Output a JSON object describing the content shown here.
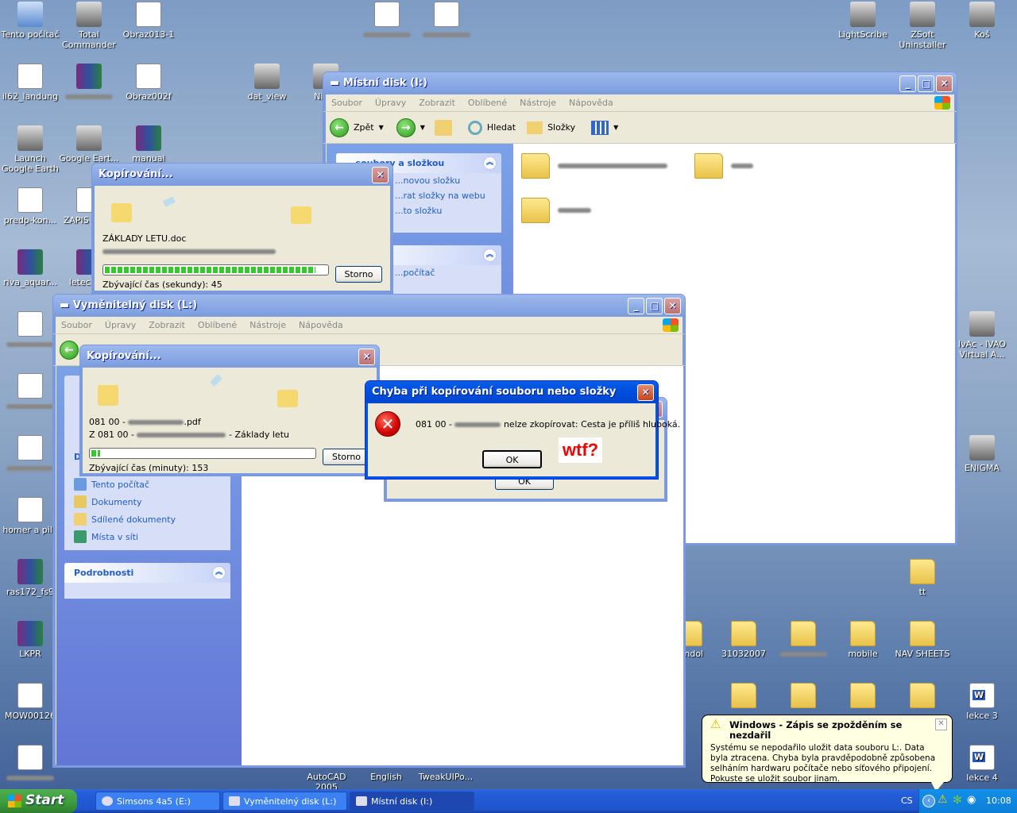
{
  "desktop": {
    "icons": [
      {
        "label": "Tento počítač",
        "type": "pc"
      },
      {
        "label": "Total Commander",
        "type": "app"
      },
      {
        "label": "Obraz013-1",
        "type": "file"
      },
      {
        "label": "",
        "type": "file",
        "blurred": true
      },
      {
        "label": "",
        "type": "file",
        "blurred": true
      },
      {
        "label": "LightScribe",
        "type": "app"
      },
      {
        "label": "ZSoft Uninstaller",
        "type": "app"
      },
      {
        "label": "Koš",
        "type": "app"
      },
      {
        "label": "il62_landung",
        "type": "file"
      },
      {
        "label": "",
        "type": "rar",
        "blurred": true
      },
      {
        "label": "Obraz002f",
        "type": "file"
      },
      {
        "label": "dat_view",
        "type": "app"
      },
      {
        "label": "Nitr...",
        "type": "app"
      },
      {
        "label": "Launch Google Earth",
        "type": "app"
      },
      {
        "label": "Google Eart...",
        "type": "app"
      },
      {
        "label": "manual",
        "type": "rar"
      },
      {
        "label": "predp-kon...",
        "type": "file"
      },
      {
        "label": "ZAPIS LET...",
        "type": "file"
      },
      {
        "label": "riva_aquar...",
        "type": "rar"
      },
      {
        "label": "letecka...",
        "type": "rar"
      },
      {
        "label": "",
        "type": "file",
        "blurred": true
      },
      {
        "label": "",
        "type": "file",
        "blurred": true
      },
      {
        "label": "",
        "type": "file",
        "blurred": true
      },
      {
        "label": "homer a pilo",
        "type": "file"
      },
      {
        "label": "ras172_fs9",
        "type": "rar"
      },
      {
        "label": "LKPR",
        "type": "rar"
      },
      {
        "label": "MOW00126",
        "type": "file"
      },
      {
        "label": "",
        "type": "file",
        "blurred": true
      },
      {
        "label": "IvAc - IVAO Virtual A...",
        "type": "app"
      },
      {
        "label": "ENIGMA",
        "type": "app"
      },
      {
        "label": "tt",
        "type": "folder"
      },
      {
        "label": "...ndol",
        "type": "folder"
      },
      {
        "label": "31032007",
        "type": "folder"
      },
      {
        "label": "",
        "type": "folder",
        "blurred": true
      },
      {
        "label": "mobile",
        "type": "folder"
      },
      {
        "label": "NAV SHEETS",
        "type": "folder"
      },
      {
        "label": "",
        "type": "folder"
      },
      {
        "label": "",
        "type": "folder"
      },
      {
        "label": "",
        "type": "folder"
      },
      {
        "label": "",
        "type": "folder"
      },
      {
        "label": "lekce 3",
        "type": "word"
      },
      {
        "label": "lekce 4",
        "type": "word"
      },
      {
        "label": "AutoCAD 2005",
        "type": "none"
      },
      {
        "label": "English",
        "type": "none"
      },
      {
        "label": "TweakUIPo...",
        "type": "none"
      }
    ]
  },
  "menu": [
    "Soubor",
    "Úpravy",
    "Zobrazit",
    "Oblíbené",
    "Nástroje",
    "Nápověda"
  ],
  "win_i": {
    "title": "Místní disk (I:)",
    "toolbar": {
      "back": "Zpět",
      "search": "Hledat",
      "folders": "Složky"
    },
    "task_panel": {
      "title": "...soubory a složkou",
      "links": [
        "...novou složku",
        "...rat složky na webu",
        "...to složku"
      ]
    },
    "other_panel": {
      "links": [
        "...počítač"
      ]
    },
    "folders": [
      "",
      "",
      ""
    ]
  },
  "win_l": {
    "title": "Vyměnitelný disk (L:)",
    "places_panel": {
      "title": "D...",
      "links": [
        "Tento počítač",
        "Dokumenty",
        "Sdílené dokumenty",
        "Místa v síti"
      ]
    },
    "details_panel": {
      "title": "Podrobnosti"
    }
  },
  "copy1": {
    "title": "Kopírování...",
    "file": "ZÁKLADY LETU.doc",
    "progress_pct": 95,
    "remaining": "Zbývající čas (sekundy): 45",
    "cancel": "Storno"
  },
  "copy2": {
    "title": "Kopírování...",
    "file_prefix": "081 00 - ",
    "file_suffix": ".pdf",
    "from_prefix": "Z 081 00 - ",
    "from_suffix": " - Základy letu",
    "progress_pct": 4,
    "remaining": "Zbývající čas (minuty): 153",
    "cancel": "Storno"
  },
  "behind_dialog": {
    "ok": "OK"
  },
  "error_dialog": {
    "title": "Chyba při kopírování souboru nebo složky",
    "msg_prefix": "081 00 - ",
    "msg_suffix": " nelze zkopírovat: Cesta je příliš hluboká.",
    "ok": "OK",
    "annotation": "wtf?"
  },
  "balloon": {
    "title": "Windows - Zápis se zpožděním se nezdařil",
    "body": "Systému se nepodařilo uložit data souboru L:. Data byla ztracena. Chyba byla pravděpodobně způsobena selháním hardwaru počítače nebo síťového připojení. Pokuste se uložit soubor jinam."
  },
  "taskbar": {
    "start": "Start",
    "tasks": [
      {
        "label": "Simsons 4a5 (E:)",
        "active": false
      },
      {
        "label": "Vyměnitelný disk (L:)",
        "active": false
      },
      {
        "label": "Místní disk (I:)",
        "active": true
      }
    ],
    "lang": "CS",
    "clock": "10:08"
  },
  "colors": {
    "titlebar": "#0054e3",
    "error_red": "#e00000",
    "annotation": "#ff0000"
  }
}
